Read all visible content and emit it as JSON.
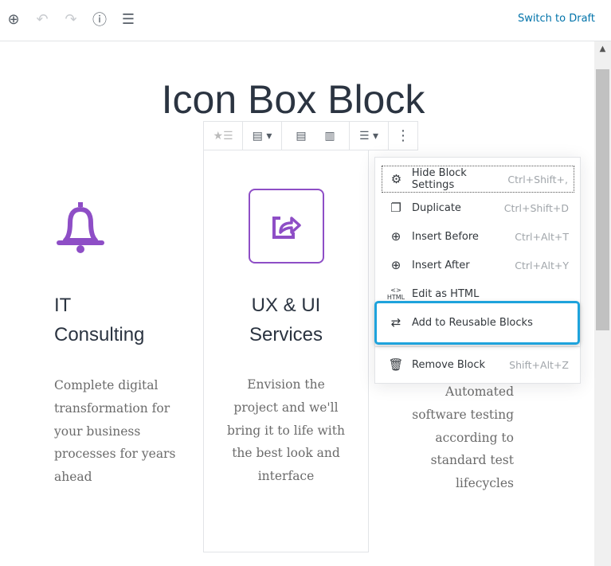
{
  "topbar": {
    "switch_label": "Switch to Draft",
    "icons": [
      "add-block-icon",
      "undo-icon",
      "redo-icon",
      "info-icon",
      "outline-icon"
    ]
  },
  "page": {
    "title": "Icon Box Block"
  },
  "columns": [
    {
      "heading_line1": "IT",
      "heading_line2": "Consulting",
      "text": [
        "Complete digital",
        "transformation for",
        "your business",
        "processes for years",
        "ahead"
      ],
      "icon": "bell-icon"
    },
    {
      "heading_line1": "UX & UI",
      "heading_line2": "Services",
      "text": [
        "Envision the",
        "project and we'll",
        "bring it to life with",
        "the best look and",
        "interface"
      ],
      "icon": "share-icon"
    },
    {
      "text": [
        "Automated",
        "software testing",
        "according to",
        "standard test",
        "lifecycles"
      ]
    }
  ],
  "accent_color": "#8e4ec6",
  "highlight_color": "#1ea3dc",
  "menu": {
    "items": [
      {
        "label": "Hide Block Settings",
        "shortcut": "Ctrl+Shift+,",
        "icon": "gear-icon"
      },
      {
        "label": "Duplicate",
        "shortcut": "Ctrl+Shift+D",
        "icon": "duplicate-icon"
      },
      {
        "label": "Insert Before",
        "shortcut": "Ctrl+Alt+T",
        "icon": "insert-before-icon"
      },
      {
        "label": "Insert After",
        "shortcut": "Ctrl+Alt+Y",
        "icon": "insert-after-icon"
      },
      {
        "label": "Edit as HTML",
        "shortcut": "",
        "icon": "html-icon"
      },
      {
        "label": "Add to Reusable Blocks",
        "shortcut": "",
        "icon": "reusable-icon"
      },
      {
        "label": "Remove Block",
        "shortcut": "Shift+Alt+Z",
        "icon": "trash-icon"
      }
    ]
  }
}
